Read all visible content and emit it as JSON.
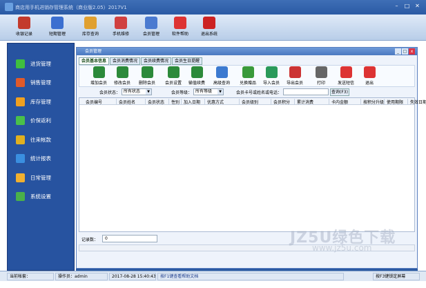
{
  "window": {
    "title": "商店用手机进销存管理系统（商业版2.05）2017V1"
  },
  "toolbar": [
    {
      "label": "收银记录",
      "icon": "register-icon",
      "color": "#c33a2c"
    },
    {
      "label": "短期管理",
      "icon": "people-icon",
      "color": "#3b6fd0"
    },
    {
      "label": "库存查询",
      "icon": "document-icon",
      "color": "#e0a030"
    },
    {
      "label": "手机维修",
      "icon": "tools-icon",
      "color": "#d04040"
    },
    {
      "label": "会员管理",
      "icon": "members-icon",
      "color": "#4a7ad0"
    },
    {
      "label": "软件帮助",
      "icon": "help-icon",
      "color": "#d33"
    },
    {
      "label": "退出系统",
      "icon": "power-icon",
      "color": "#c22"
    }
  ],
  "sidebar": [
    {
      "label": "进货管理",
      "icon": "plus-icon",
      "color": "#3fbf3f"
    },
    {
      "label": "销售管理",
      "icon": "pie-icon",
      "color": "#e05a2a"
    },
    {
      "label": "库存管理",
      "icon": "star-icon",
      "color": "#f0a020"
    },
    {
      "label": "价保返利",
      "icon": "dollar-icon",
      "color": "#4ac04a"
    },
    {
      "label": "往来帐款",
      "icon": "dollar-icon",
      "color": "#e0b020"
    },
    {
      "label": "统计报表",
      "icon": "bar-chart-icon",
      "color": "#3a8fe0"
    },
    {
      "label": "日常管理",
      "icon": "folder-icon",
      "color": "#f0b030"
    },
    {
      "label": "系统设置",
      "icon": "gear-icon",
      "color": "#4ab04a"
    }
  ],
  "member_window": {
    "title": "会员管理",
    "tabs": [
      "会员基本信息",
      "会员消费情况",
      "会员续费情况",
      "会员生日提醒"
    ],
    "buttons": [
      {
        "label": "增加会员",
        "icon": "add-user-icon",
        "color": "#2c8a3a"
      },
      {
        "label": "修改会员",
        "icon": "edit-user-icon",
        "color": "#2c8a3a"
      },
      {
        "label": "删除会员",
        "icon": "delete-user-icon",
        "color": "#2c8a3a"
      },
      {
        "label": "会员设置",
        "icon": "user-settings-icon",
        "color": "#2c8a3a"
      },
      {
        "label": "输值续费",
        "icon": "recharge-icon",
        "color": "#2c8a3a"
      },
      {
        "label": "高级查询",
        "icon": "magnifier-icon",
        "color": "#3c7ad0"
      },
      {
        "label": "兑换赠品",
        "icon": "gift-icon",
        "color": "#3a9a3a"
      },
      {
        "label": "导入会员",
        "icon": "import-icon",
        "color": "#2a9a5a"
      },
      {
        "label": "导出会员",
        "icon": "export-icon",
        "color": "#c33"
      },
      {
        "label": "打印",
        "icon": "printer-icon",
        "color": "#666"
      },
      {
        "label": "发送短信",
        "icon": "sms-icon",
        "color": "#d33"
      },
      {
        "label": "退出",
        "icon": "close-icon",
        "color": "#d33"
      }
    ],
    "filter": {
      "status_label": "会员状态：",
      "status_value": "所有状态",
      "level_label": "会员等级：",
      "level_value": "所有等级",
      "card_label": "会员卡号或姓名或电话：",
      "search_label": "查询(F3)"
    },
    "columns": [
      "会员编号",
      "会员姓名",
      "会员状态",
      "性别",
      "加入日期",
      "优惠方式",
      "会员级别",
      "会员积分",
      "累计消费",
      "卡内金额",
      "按积分升级",
      "使用期限",
      "失效日期"
    ],
    "record_label": "记录数：",
    "record_count": "0"
  },
  "status": {
    "user_label": "当前帐套：",
    "operator_label": "操作员：admin",
    "datetime": "2017-08-28 15:40:43",
    "hint": "按F1键查看帮助文档",
    "lock": "按F3键锁定屏幕"
  },
  "watermark": {
    "text": "JZ5U绿色下载",
    "url": "www.jz5u.com"
  }
}
